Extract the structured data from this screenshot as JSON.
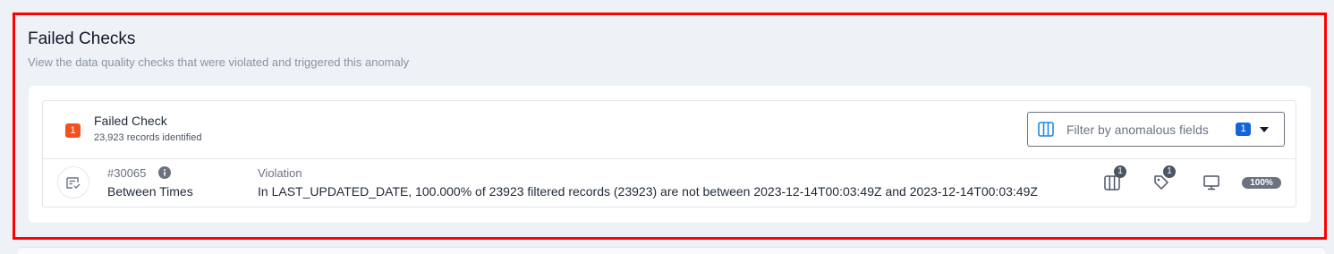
{
  "section": {
    "title": "Failed Checks",
    "subtitle": "View the data quality checks that were violated and triggered this anomaly"
  },
  "summary": {
    "count": "1",
    "title": "Failed Check",
    "records": "23,923 records identified"
  },
  "filter": {
    "placeholder": "Filter by anomalous fields",
    "badge": "1",
    "caret_icon": "caret-down-icon",
    "icon": "columns-icon"
  },
  "check": {
    "id": "#30065",
    "name": "Between Times",
    "icon": "check-list-icon",
    "violation_label": "Violation",
    "violation_text": "In LAST_UPDATED_DATE, 100.000% of 23923 filtered records (23923) are not between 2023-12-14T00:03:49Z and 2023-12-14T00:03:49Z",
    "fields_count": "1",
    "tags_count": "1",
    "coverage": "100%"
  },
  "colors": {
    "highlight": "#ff0000",
    "count_badge": "#f4511e",
    "filter_badge": "#1565d8",
    "accent": "#1e88e5"
  }
}
